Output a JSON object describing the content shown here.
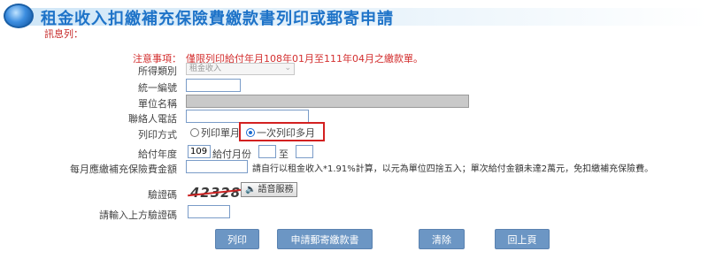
{
  "header": {
    "title": "租金收入扣繳補充保險費繳款書列印或郵寄申請",
    "orb_icon": "globe-orb-icon"
  },
  "message": {
    "label": "訊息列："
  },
  "notice": {
    "label": "注意事項：",
    "text": "僅限列印給付年月108年01月至111年04月之繳款單。"
  },
  "fields": {
    "income_type": {
      "label": "所得類別",
      "value": "租金收入"
    },
    "tax_id": {
      "label": "統一編號",
      "value": ""
    },
    "unit_name": {
      "label": "單位名稱",
      "value": ""
    },
    "phone": {
      "label": "聯絡人電話",
      "value": ""
    },
    "print_mode": {
      "label": "列印方式",
      "option_single": "列印單月",
      "option_multi": "一次列印多月",
      "selected": "option_multi"
    },
    "pay_year": {
      "label": "給付年度",
      "value": "109"
    },
    "pay_month": {
      "label": "給付月份",
      "to": "至",
      "from_value": "",
      "to_value": ""
    },
    "monthly_amount": {
      "label": "每月應繳補充保險費金額",
      "value": "",
      "hint": "請自行以租金收入*1.91%計算，以元為單位四捨五入；單次給付金額未達2萬元，免扣繳補充保險費。"
    },
    "captcha": {
      "label": "驗證碼",
      "image_text": "42328",
      "audio_label": "語音服務"
    },
    "captcha_input": {
      "label": "請輸入上方驗證碼",
      "value": ""
    }
  },
  "buttons": {
    "print": "列印",
    "mail": "申請郵寄繳款書",
    "clear": "清除",
    "back": "回上頁"
  },
  "colors": {
    "title": "#1e73c8",
    "notice": "#d32f2f",
    "button": "#6c96c4",
    "highlight": "#d32020"
  }
}
